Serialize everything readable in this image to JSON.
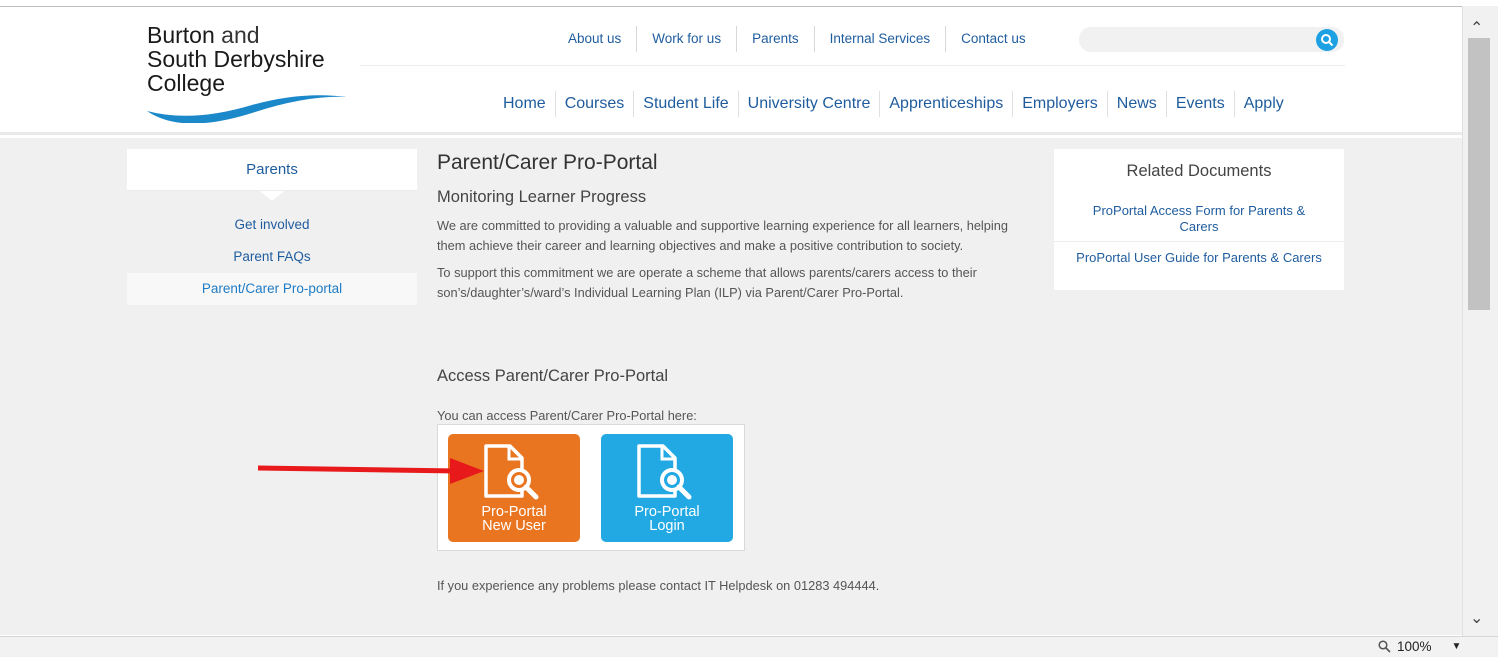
{
  "logo": {
    "line1_bold": "Burton",
    "line1_light": " and",
    "line2": "South Derbyshire",
    "line3": "College"
  },
  "util_nav": [
    "About us",
    "Work for us",
    "Parents",
    "Internal Services",
    "Contact us"
  ],
  "main_nav": [
    "Home",
    "Courses",
    "Student Life",
    "University Centre",
    "Apprenticeships",
    "Employers",
    "News",
    "Events",
    "Apply"
  ],
  "sidebar": {
    "title": "Parents",
    "items": [
      {
        "label": "Get involved"
      },
      {
        "label": "Parent FAQs"
      },
      {
        "label": "Parent/Carer Pro-portal"
      }
    ]
  },
  "article": {
    "title": "Parent/Carer Pro-Portal",
    "subtitle": "Monitoring Learner Progress",
    "para1": "We are committed to providing a valuable and supportive learning experience for all learners, helping them achieve their career and learning objectives and make a positive contribution to society.",
    "para2": "To support this commitment we are operate a scheme that allows parents/carers access to their son’s/daughter’s/ward’s Individual Learning Plan (ILP) via Parent/Carer Pro-Portal.",
    "access_heading": "Access Parent/Carer Pro-Portal",
    "access_text": "You can access Parent/Carer Pro-Portal here:",
    "help_text": "If you experience any problems please contact IT Helpdesk on 01283 494444."
  },
  "tiles": {
    "new_user": {
      "line1": "Pro-Portal",
      "line2": "New User"
    },
    "login": {
      "line1": "Pro-Portal",
      "line2": "Login"
    }
  },
  "related": {
    "title": "Related Documents",
    "items": [
      {
        "label": "ProPortal Access Form for Parents & Carers"
      },
      {
        "label": "ProPortal User Guide for Parents & Carers"
      }
    ]
  },
  "statusbar": {
    "zoom": "100%"
  },
  "colors": {
    "link": "#1f5c9e",
    "orange_tile": "#e97520",
    "blue_tile": "#22a9e3",
    "arrow": "#e8191b"
  },
  "icons": [
    "search-icon",
    "document-search-icon",
    "red-arrow-annotation",
    "chevron-up-icon",
    "chevron-down-icon",
    "zoom-icon"
  ]
}
